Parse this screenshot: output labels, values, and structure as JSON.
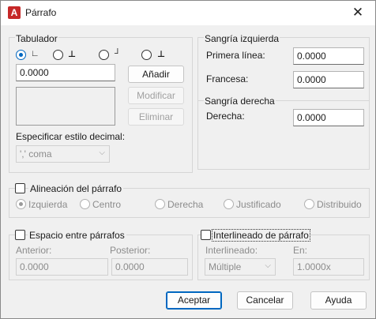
{
  "window": {
    "title": "Párrafo",
    "app_icon_letter": "A",
    "close_glyph": "✕"
  },
  "tabulador": {
    "group_label": "Tabulador",
    "value": "0.0000",
    "add_button": "Añadir",
    "modify_button": "Modificar",
    "delete_button": "Eliminar",
    "decimal_label": "Especificar estilo decimal:",
    "decimal_value": "',' coma",
    "tab_types": [
      {
        "glyph": "∟",
        "selected": true
      },
      {
        "glyph": "⊥",
        "selected": false
      },
      {
        "glyph": "┘",
        "selected": false
      },
      {
        "glyph": "⊥",
        "selected": false
      }
    ]
  },
  "sangria_izquierda": {
    "group_label": "Sangría izquierda",
    "first_line_label": "Primera línea:",
    "first_line_value": "0.0000",
    "hanging_label": "Francesa:",
    "hanging_value": "0.0000"
  },
  "sangria_derecha": {
    "group_label": "Sangría derecha",
    "right_label": "Derecha:",
    "right_value": "0.0000"
  },
  "alineacion": {
    "label": "Alineación del párrafo",
    "options": [
      "Izquierda",
      "Centro",
      "Derecha",
      "Justificado",
      "Distribuido"
    ]
  },
  "espacio": {
    "label": "Espacio entre párrafos",
    "before_label": "Anterior:",
    "before_value": "0.0000",
    "after_label": "Posterior:",
    "after_value": "0.0000"
  },
  "interlineado": {
    "label": "Interlineado de párrafo",
    "spacing_label": "Interlineado:",
    "spacing_value": "Múltiple",
    "at_label": "En:",
    "at_value": "1.0000x"
  },
  "footer": {
    "ok": "Aceptar",
    "cancel": "Cancelar",
    "help": "Ayuda"
  },
  "colors": {
    "accent": "#0067c0",
    "app_icon": "#c62828"
  }
}
